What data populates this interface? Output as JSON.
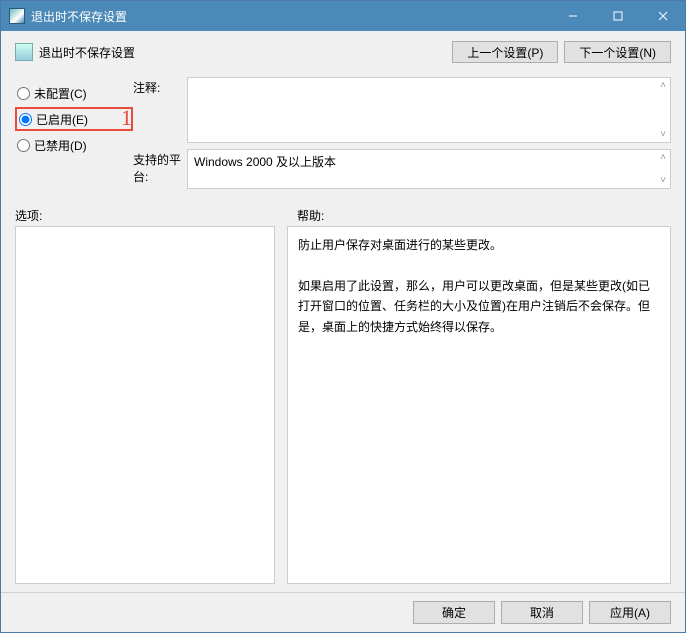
{
  "window": {
    "title": "退出时不保存设置"
  },
  "header": {
    "title": "退出时不保存设置",
    "prev_btn": "上一个设置(P)",
    "next_btn": "下一个设置(N)"
  },
  "radios": {
    "not_configured": "未配置(C)",
    "enabled": "已启用(E)",
    "disabled": "已禁用(D)"
  },
  "annotation": {
    "one": "1"
  },
  "labels": {
    "comment": "注释:",
    "platform": "支持的平台:",
    "options": "选项:",
    "help": "帮助:"
  },
  "platform_value": "Windows 2000 及以上版本",
  "help_text": {
    "p1": "防止用户保存对桌面进行的某些更改。",
    "p2": "如果启用了此设置，那么，用户可以更改桌面，但是某些更改(如已打开窗口的位置、任务栏的大小及位置)在用户注销后不会保存。但是，桌面上的快捷方式始终得以保存。"
  },
  "footer": {
    "ok": "确定",
    "cancel": "取消",
    "apply": "应用(A)"
  }
}
